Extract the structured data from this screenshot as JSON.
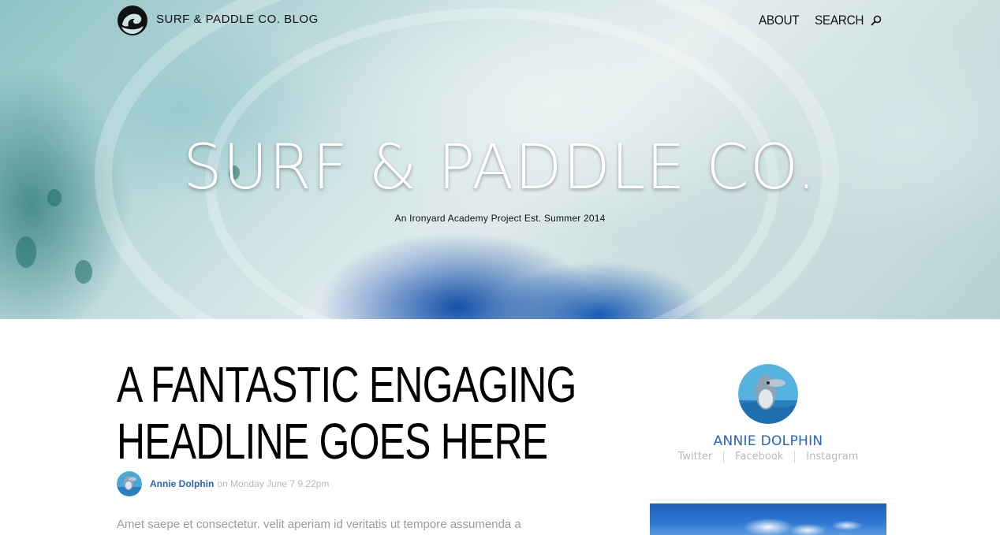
{
  "nav": {
    "brand": "SURF & PADDLE CO. BLOG",
    "logo_icon": "wave-logo-icon",
    "about_label": "ABOUT",
    "search_label": "SEARCH",
    "search_icon": "search-icon"
  },
  "hero": {
    "title": "SURF & PADDLE CO.",
    "subtitle": "An Ironyard Academy Project Est. Summer 2014"
  },
  "article": {
    "headline": "A FANTASTIC ENGAGING HEADLINE GOES HERE",
    "author": "Annie Dolphin",
    "date_text": "on Monday June 7 9.22pm",
    "excerpt": "Amet saepe et consectetur. velit aperiam id veritatis ut tempore assumenda a"
  },
  "sidebar": {
    "author_name": "ANNIE DOLPHIN",
    "social": [
      "Twitter",
      "Facebook",
      "Instagram"
    ]
  },
  "colors": {
    "link_blue": "#2a64b8",
    "muted_gray": "#b9b9b9",
    "text_dark": "#111111"
  }
}
